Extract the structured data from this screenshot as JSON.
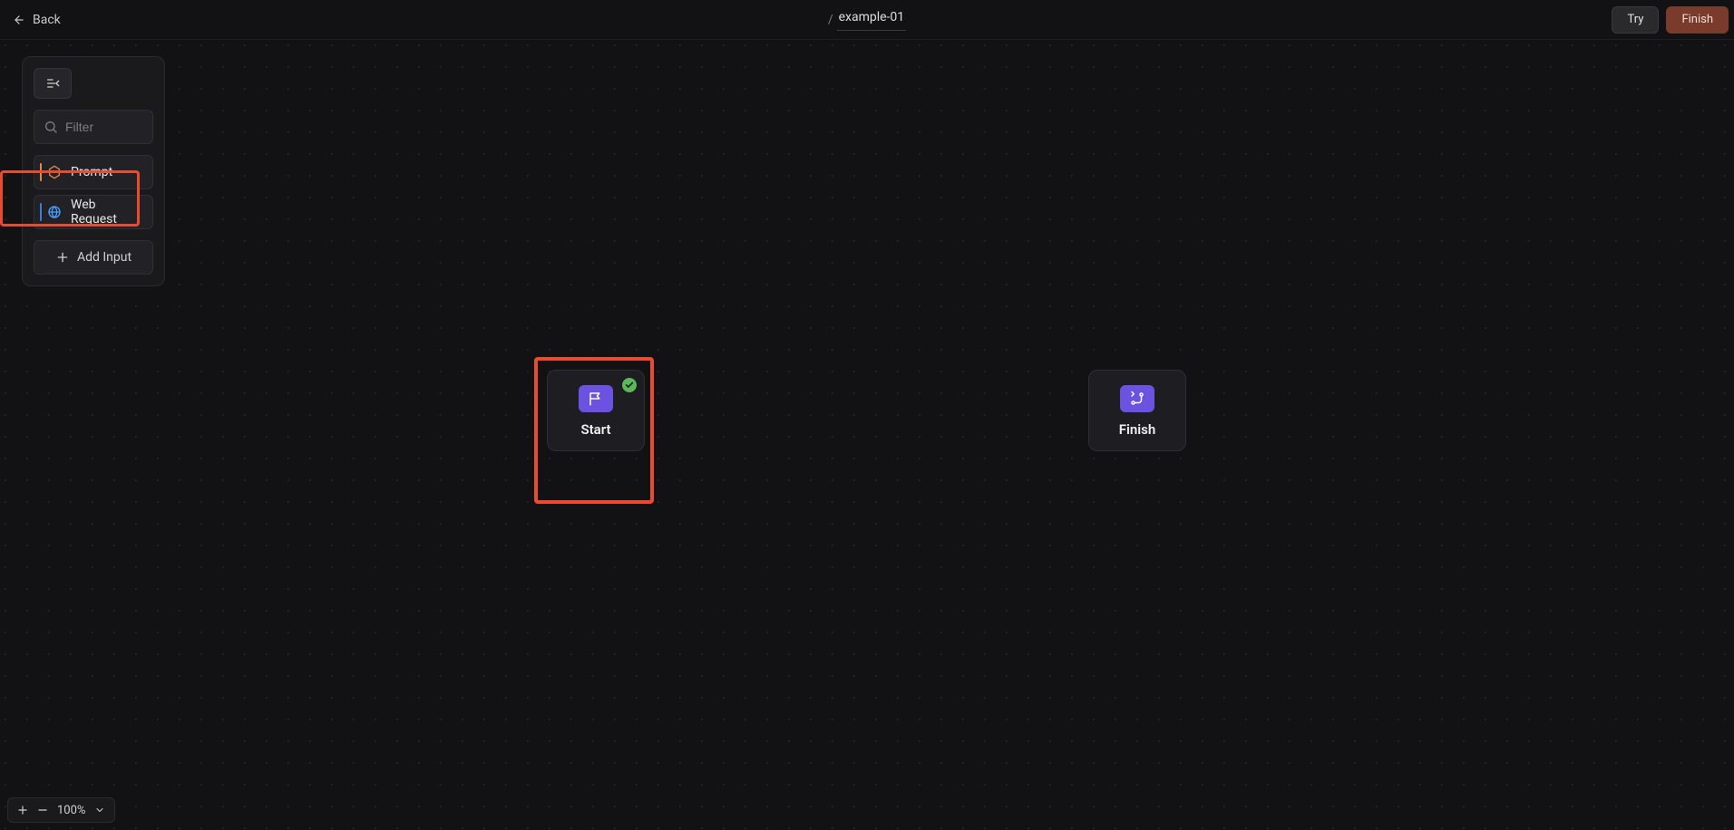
{
  "topbar": {
    "back_label": "Back",
    "title_prefix": "/",
    "title": "example-01",
    "try_label": "Try",
    "finish_label": "Finish"
  },
  "panel": {
    "filter_placeholder": "Filter",
    "items": [
      {
        "label": "Prompt"
      },
      {
        "label": "Web Request"
      }
    ],
    "add_input_label": "Add Input"
  },
  "canvas": {
    "start_label": "Start",
    "finish_label": "Finish"
  },
  "zoom": {
    "value": "100%"
  },
  "highlights": {
    "prompt_item": true,
    "start_node": true
  }
}
